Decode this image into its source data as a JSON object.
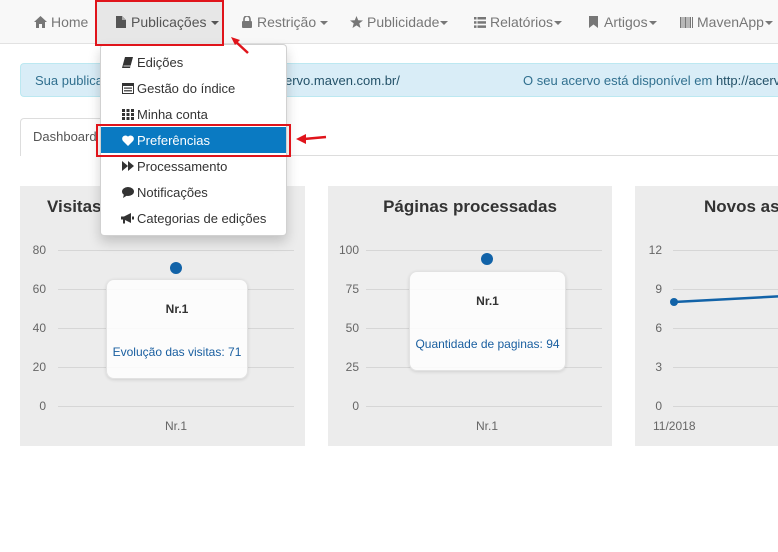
{
  "navbar": {
    "items": [
      {
        "label": "Home",
        "icon": "home-icon"
      },
      {
        "label": "Publicações",
        "icon": "file-icon"
      },
      {
        "label": "Restrição",
        "icon": "lock-icon"
      },
      {
        "label": "Publicidade",
        "icon": "star-icon"
      },
      {
        "label": "Relatórios",
        "icon": "list-icon"
      },
      {
        "label": "Artigos",
        "icon": "bookmark-icon"
      },
      {
        "label": "MavenApp",
        "icon": "barcode-icon"
      }
    ]
  },
  "dropdown": {
    "items": [
      {
        "label": "Edições",
        "icon": "book-icon"
      },
      {
        "label": "Gestão do índice",
        "icon": "list-alt-icon"
      },
      {
        "label": "Minha conta",
        "icon": "th-icon"
      },
      {
        "label": "Preferências",
        "icon": "heart-icon"
      },
      {
        "label": "Processamento",
        "icon": "forward-icon"
      },
      {
        "label": "Notificações",
        "icon": "comment-icon"
      },
      {
        "label": "Categorias de edições",
        "icon": "bullhorn-icon"
      }
    ]
  },
  "alert": {
    "left_text": "Sua publica",
    "left_link": "ervo.maven.com.br/",
    "right_text": "O seu acervo está disponível em ",
    "right_link": "http://acerv"
  },
  "tabs": [
    {
      "label": "Dashboard"
    }
  ],
  "colors": {
    "accent": "#0a7ac2",
    "annotation": "#e0141b",
    "series": "#1263a8",
    "alert_bg": "#d9edf7"
  },
  "cards": [
    {
      "title": "Visitas",
      "chart_data": {
        "type": "scatter",
        "categories": [
          "Nr.1"
        ],
        "values": [
          71
        ],
        "ylim": [
          0,
          80
        ],
        "yticks": [
          "80",
          "60",
          "40",
          "20",
          "0"
        ],
        "tooltip": {
          "header": "Nr.1",
          "value": "Evolução das visitas: 71"
        }
      }
    },
    {
      "title": "Páginas processadas",
      "chart_data": {
        "type": "scatter",
        "categories": [
          "Nr.1"
        ],
        "values": [
          94
        ],
        "ylim": [
          0,
          100
        ],
        "yticks": [
          "100",
          "75",
          "50",
          "25",
          "0"
        ],
        "tooltip": {
          "header": "Nr.1",
          "value": "Quantidade de paginas: 94"
        }
      }
    },
    {
      "title": "Novos as",
      "chart_data": {
        "type": "line",
        "categories": [
          "11/2018"
        ],
        "values": [
          8,
          8.5
        ],
        "ylim": [
          0,
          12
        ],
        "yticks": [
          "12",
          "9",
          "6",
          "3",
          "0"
        ]
      }
    }
  ]
}
